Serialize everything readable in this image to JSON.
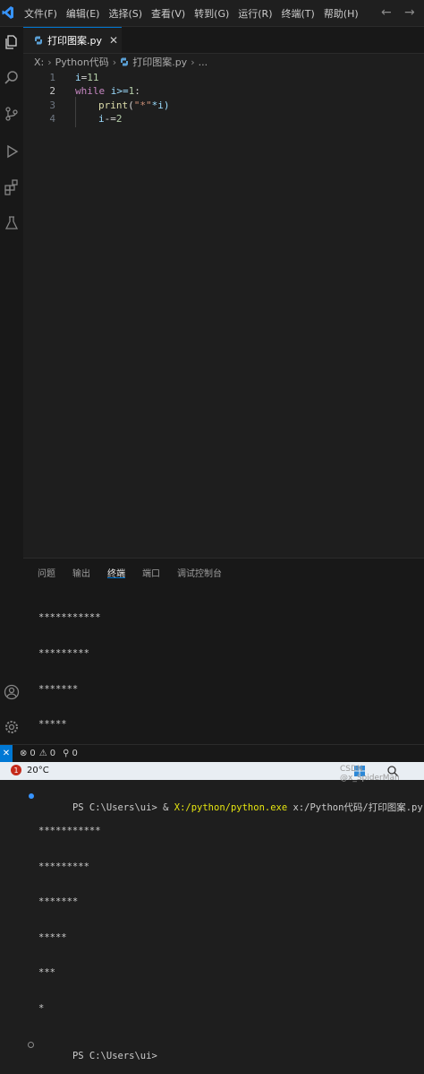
{
  "colors": {
    "accent": "#0078d4",
    "editor_bg": "#1e1e1e",
    "keyword": "#c586c0",
    "string": "#ce9178",
    "number": "#b5cea8",
    "terminal_path": "#e5e510"
  },
  "menu": [
    "文件(F)",
    "编辑(E)",
    "选择(S)",
    "查看(V)",
    "转到(G)",
    "运行(R)",
    "终端(T)",
    "帮助(H)"
  ],
  "activity_icons": [
    "explorer-icon",
    "search-icon",
    "source-control-icon",
    "run-debug-icon",
    "extensions-icon",
    "testing-icon",
    "account-icon",
    "settings-gear-icon"
  ],
  "tab": {
    "name": "打印图案.py",
    "close": "✕"
  },
  "breadcrumb": {
    "drive": "X:",
    "folder": "Python代码",
    "file": "打印图案.py",
    "more": "..."
  },
  "editor": {
    "line_numbers": [
      "1",
      "2",
      "3",
      "4"
    ],
    "code": {
      "l1_var": "i",
      "l1_op": "=",
      "l1_num": "11",
      "l2_kw": "while",
      "l2_cond": " i>=",
      "l2_num": "1",
      "l2_colon": ":",
      "l3_fn": "print",
      "l3_open": "(",
      "l3_str": "\"*\"",
      "l3_rest": "*i)",
      "l4_var": "i",
      "l4_op": "-=",
      "l4_num": "2"
    }
  },
  "panel": {
    "tabs": [
      "问题",
      "输出",
      "终端",
      "端口",
      "调试控制台"
    ],
    "active_tab": "终端",
    "terminal": {
      "first_output": [
        "***********",
        "*********",
        "*******",
        "*****",
        "***"
      ],
      "prompt": "PS C:\\Users\\ui> ",
      "command_amp": "& ",
      "command_exe": "X:/python/python.exe",
      "command_arg": " x:/Python代码/打印图案.py",
      "second_output": [
        "***********",
        "*********",
        "*******",
        "*****",
        "***",
        "*"
      ],
      "final_prompt": "PS C:\\Users\\ui>"
    }
  },
  "status": {
    "remote": "✕",
    "errors": "0",
    "warnings": "0",
    "ports": "0"
  },
  "taskbar": {
    "badge": "1",
    "temperature": "20°C",
    "watermark": "CSDN @x_SpiderMan"
  }
}
